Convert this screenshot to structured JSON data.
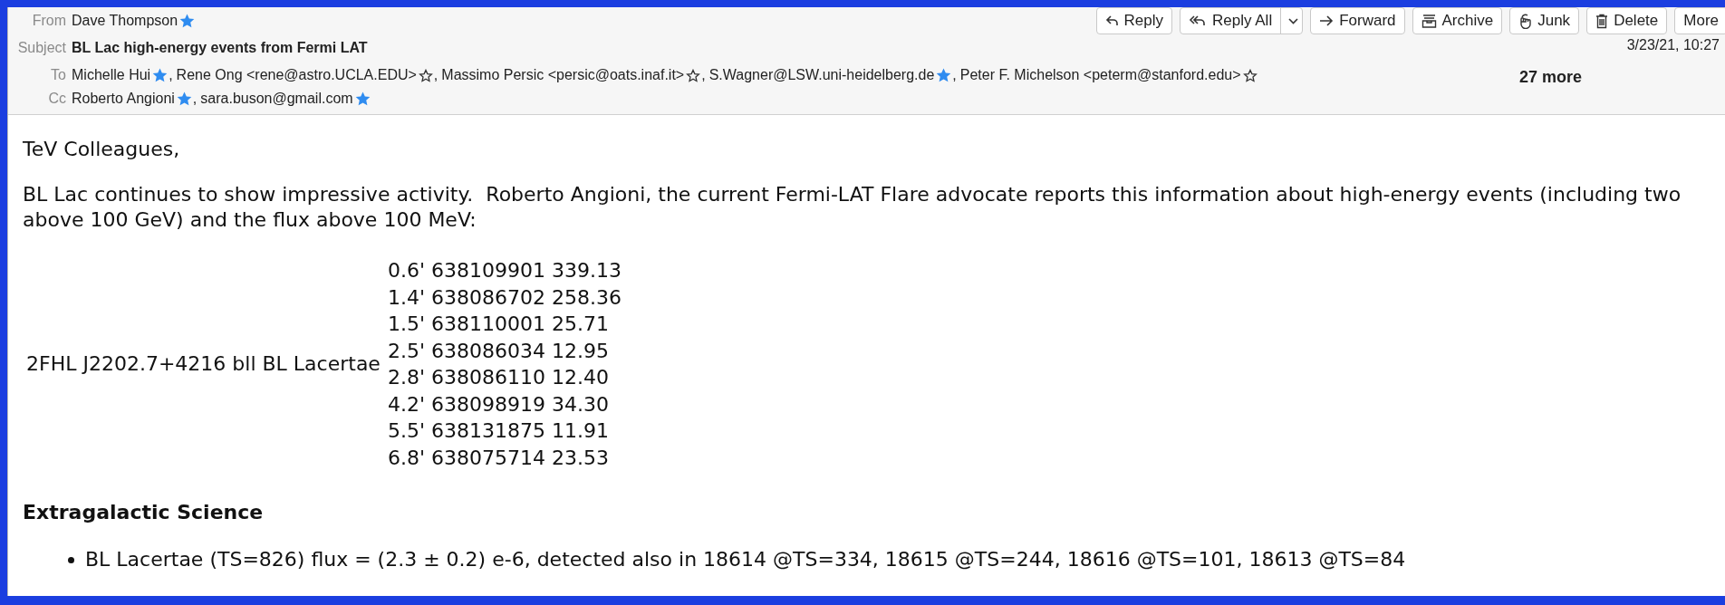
{
  "toolbar": {
    "buttons": [
      {
        "kind": "reply",
        "label": "Reply",
        "has_menu": false
      },
      {
        "kind": "reply-all",
        "label": "Reply All",
        "has_menu": true
      },
      {
        "kind": "forward",
        "label": "Forward",
        "has_menu": false
      },
      {
        "kind": "archive",
        "label": "Archive",
        "has_menu": false
      },
      {
        "kind": "junk",
        "label": "Junk",
        "has_menu": false
      },
      {
        "kind": "delete",
        "label": "Delete",
        "has_menu": false
      },
      {
        "kind": "more",
        "label": "More",
        "has_menu": false
      }
    ]
  },
  "header": {
    "from": {
      "label": "From",
      "people": [
        {
          "text": "Dave Thompson",
          "starred": true
        }
      ]
    },
    "subject": {
      "label": "Subject",
      "text": "BL Lac high-energy events from Fermi LAT"
    },
    "date": "3/23/21, 10:27",
    "to": {
      "label": "To",
      "more": "27 more",
      "people": [
        {
          "text": "Michelle Hui",
          "starred": true,
          "sep": ","
        },
        {
          "text": "Rene Ong <rene@astro.UCLA.EDU>",
          "starred": false,
          "sep": ","
        },
        {
          "text": "Massimo Persic <persic@oats.inaf.it>",
          "starred": false,
          "sep": ","
        },
        {
          "text": "S.Wagner@LSW.uni-heidelberg.de",
          "starred": true,
          "sep": ","
        },
        {
          "text": "Peter F. Michelson <peterm@stanford.edu>",
          "starred": false
        }
      ]
    },
    "cc": {
      "label": "Cc",
      "people": [
        {
          "text": "Roberto Angioni",
          "starred": true,
          "sep": ","
        },
        {
          "text": "sara.buson@gmail.com",
          "starred": true
        }
      ]
    }
  },
  "body": {
    "greeting": "TeV Colleagues,",
    "paragraph": "BL Lac continues to show impressive activity.  Roberto Angioni, the current Fermi-LAT Flare advocate reports this information about high-energy events (including two above 100 GeV) and the flux above 100 MeV:",
    "table": {
      "source": "2FHL J2202.7+4216 bll BL Lacertae",
      "rows": [
        "0.6' 638109901 339.13",
        "1.4' 638086702 258.36",
        "1.5' 638110001 25.71",
        "2.5' 638086034 12.95",
        "2.8' 638086110 12.40",
        "4.2' 638098919 34.30",
        "5.5' 638131875 11.91",
        "6.8' 638075714 23.53"
      ]
    },
    "section_heading": "Extragalactic Science",
    "bullets": [
      "BL Lacertae (TS=826) flux = (2.3 ± 0.2) e-6, detected also in 18614 @TS=334, 18615 @TS=244, 18616 @TS=101, 18613 @TS=84"
    ]
  }
}
